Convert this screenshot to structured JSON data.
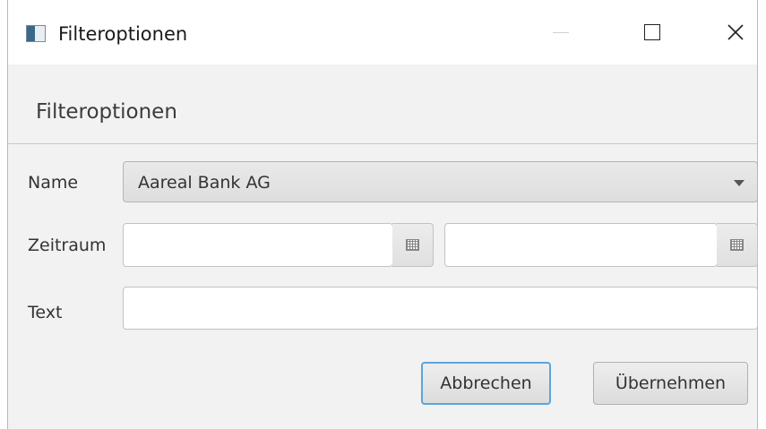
{
  "window": {
    "title": "Filteroptionen",
    "icon": "app-window-icon"
  },
  "header": {
    "title": "Filteroptionen"
  },
  "form": {
    "name_label": "Name",
    "name_value": "Aareal Bank AG",
    "zeitraum_label": "Zeitraum",
    "date_from": "",
    "date_to": "",
    "text_label": "Text",
    "text_value": ""
  },
  "buttons": {
    "cancel": "Abbrechen",
    "apply": "Übernehmen"
  },
  "colors": {
    "accent": "#5aa5dc"
  }
}
